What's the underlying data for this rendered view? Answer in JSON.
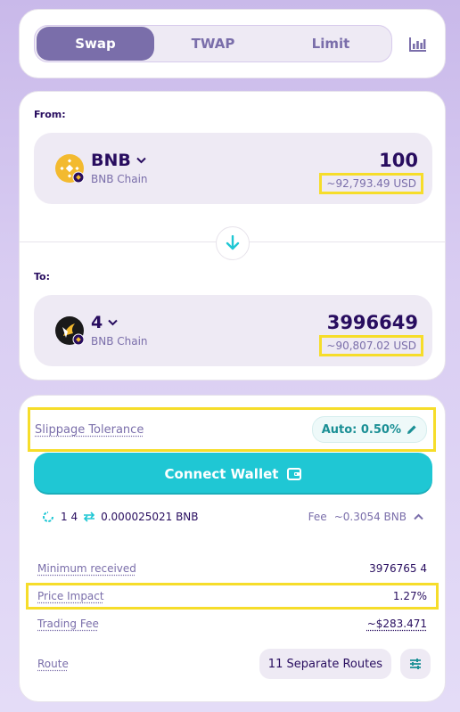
{
  "tabs": {
    "swap": "Swap",
    "twap": "TWAP",
    "limit": "Limit"
  },
  "from": {
    "label": "From:",
    "symbol": "BNB",
    "chain": "BNB Chain",
    "amount": "100",
    "usd": "~92,793.49 USD"
  },
  "to": {
    "label": "To:",
    "symbol": "4",
    "chain": "BNB Chain",
    "amount": "3996649",
    "usd": "~90,807.02 USD"
  },
  "slippage": {
    "label": "Slippage Tolerance",
    "value": "Auto: 0.50%"
  },
  "connect_label": "Connect Wallet",
  "rate": {
    "left_num": "1 4",
    "right_val": "0.000025021 BNB",
    "fee_label": "Fee",
    "fee_value": "~0.3054 BNB"
  },
  "details": {
    "min_received_label": "Minimum received",
    "min_received_value": "3976765 4",
    "price_impact_label": "Price Impact",
    "price_impact_value": "1.27%",
    "trading_fee_label": "Trading Fee",
    "trading_fee_value": "~$283.471",
    "route_label": "Route",
    "routes_button": "11 Separate Routes"
  },
  "colors": {
    "accent": "#1fc7d4",
    "primary_text": "#280d5f",
    "secondary_text": "#7a6eaa",
    "highlight": "#f6dd2a"
  }
}
